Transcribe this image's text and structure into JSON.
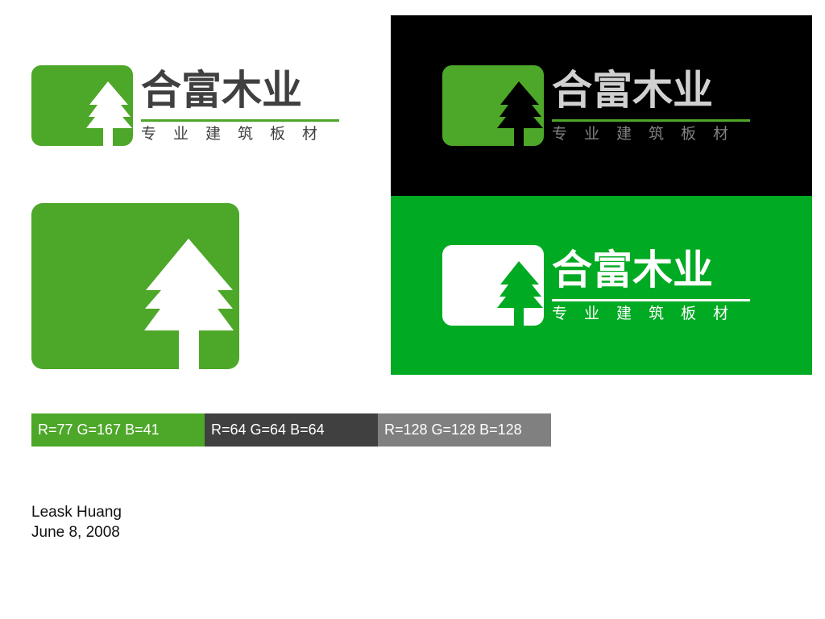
{
  "brand": {
    "name": "合富木业",
    "tagline": "专业建筑板材"
  },
  "colors": {
    "green": "#4da729",
    "dark_gray": "#404040",
    "light_gray": "#808080",
    "black": "#000000",
    "bright_green": "#00aa22",
    "white": "#ffffff",
    "light_text": "#d0d0d0"
  },
  "icons": {
    "tree": "tree-icon"
  },
  "swatches": [
    {
      "label": "R=77 G=167 B=41",
      "color": "#4da729"
    },
    {
      "label": "R=64 G=64 B=64",
      "color": "#404040"
    },
    {
      "label": "R=128 G=128 B=128",
      "color": "#808080"
    }
  ],
  "credits": {
    "author": "Leask Huang",
    "date": "June 8, 2008"
  }
}
